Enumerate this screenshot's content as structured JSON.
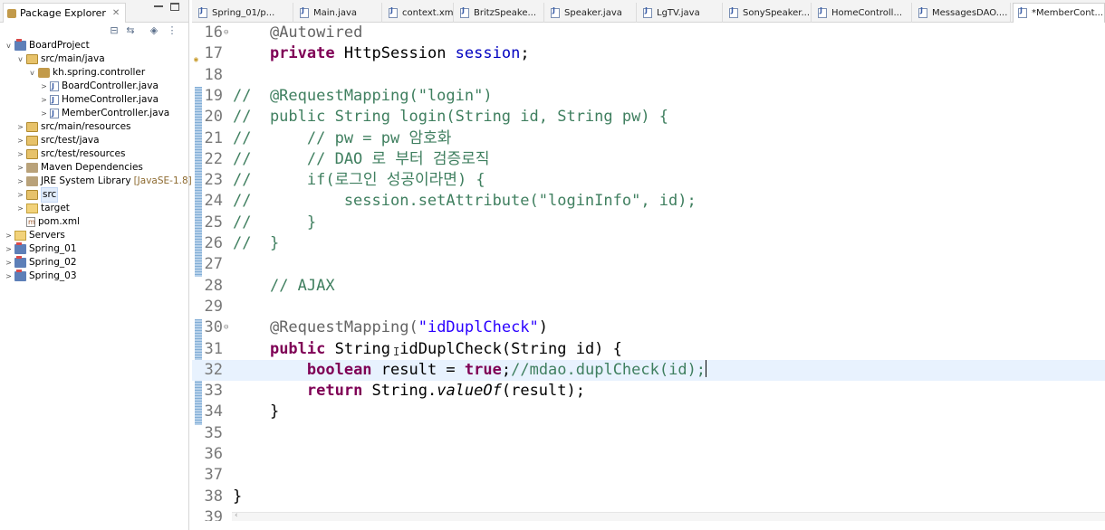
{
  "explorer": {
    "title": "Package Explorer",
    "close": "✕",
    "tree": [
      {
        "label": "BoardProject",
        "icon": "project-icon",
        "twisty": "v",
        "indent": 0
      },
      {
        "label": "src/main/java",
        "icon": "source-folder-icon",
        "twisty": "v",
        "indent": 1
      },
      {
        "label": "kh.spring.controller",
        "icon": "package-icon",
        "twisty": "v",
        "indent": 2
      },
      {
        "label": "BoardController.java",
        "icon": "java-file-icon",
        "twisty": ">",
        "indent": 3
      },
      {
        "label": "HomeController.java",
        "icon": "java-file-icon",
        "twisty": ">",
        "indent": 3
      },
      {
        "label": "MemberController.java",
        "icon": "java-file-icon",
        "twisty": ">",
        "indent": 3
      },
      {
        "label": "src/main/resources",
        "icon": "source-folder-icon",
        "twisty": ">",
        "indent": 1
      },
      {
        "label": "src/test/java",
        "icon": "source-folder-icon",
        "twisty": ">",
        "indent": 1
      },
      {
        "label": "src/test/resources",
        "icon": "source-folder-icon",
        "twisty": ">",
        "indent": 1
      },
      {
        "label": "Maven Dependencies",
        "icon": "library-icon",
        "twisty": ">",
        "indent": 1
      },
      {
        "label": "JRE System Library",
        "suffix": "[JavaSE-1.8]",
        "icon": "library-icon",
        "twisty": ">",
        "indent": 1
      },
      {
        "label": "src",
        "icon": "source-folder-icon",
        "twisty": ">",
        "indent": 1,
        "selected": true
      },
      {
        "label": "target",
        "icon": "folder-icon",
        "twisty": ">",
        "indent": 1
      },
      {
        "label": "pom.xml",
        "icon": "xml-file-icon",
        "twisty": "",
        "indent": 1
      },
      {
        "label": "Servers",
        "icon": "folder-icon",
        "twisty": ">",
        "indent": 0
      },
      {
        "label": "Spring_01",
        "icon": "project-icon",
        "twisty": ">",
        "indent": 0
      },
      {
        "label": "Spring_02",
        "icon": "project-icon",
        "twisty": ">",
        "indent": 0
      },
      {
        "label": "Spring_03",
        "icon": "project-icon",
        "twisty": ">",
        "indent": 0
      }
    ]
  },
  "editor": {
    "tabs": [
      {
        "label": "Spring_01/p...",
        "active": false
      },
      {
        "label": "Main.java",
        "active": false
      },
      {
        "label": "context.xml",
        "active": false
      },
      {
        "label": "BritzSpeake...",
        "active": false
      },
      {
        "label": "Speaker.java",
        "active": false
      },
      {
        "label": "LgTV.java",
        "active": false
      },
      {
        "label": "SonySpeaker....",
        "active": false
      },
      {
        "label": "HomeControll...",
        "active": false
      },
      {
        "label": "MessagesDAO....",
        "active": false
      },
      {
        "label": "*MemberCont...",
        "active": true
      }
    ],
    "lines": [
      {
        "num": "16",
        "fold": "⊖"
      },
      {
        "num": "17",
        "override": true
      },
      {
        "num": "18"
      },
      {
        "num": "19"
      },
      {
        "num": "20"
      },
      {
        "num": "21"
      },
      {
        "num": "22"
      },
      {
        "num": "23"
      },
      {
        "num": "24"
      },
      {
        "num": "25"
      },
      {
        "num": "26"
      },
      {
        "num": "27"
      },
      {
        "num": "28"
      },
      {
        "num": "29"
      },
      {
        "num": "30",
        "fold": "⊖"
      },
      {
        "num": "31"
      },
      {
        "num": "32",
        "current": true
      },
      {
        "num": "33"
      },
      {
        "num": "34"
      },
      {
        "num": "35"
      },
      {
        "num": "36"
      },
      {
        "num": "37"
      },
      {
        "num": "38"
      },
      {
        "num": "39"
      }
    ],
    "code": {
      "l16": {
        "ann": "@Autowired"
      },
      "l17": {
        "kw": "private",
        "type": " HttpSession ",
        "field": "session",
        "end": ";"
      },
      "l19": {
        "text": "//  @RequestMapping(\"login\")"
      },
      "l20": {
        "text": "//  public String login(String id, String pw) {"
      },
      "l21": {
        "text": "//      // pw = pw 암호화"
      },
      "l22": {
        "text": "//      // DAO 로 부터 검증로직"
      },
      "l23": {
        "text": "//      if(로그인 성공이라면) {"
      },
      "l24": {
        "text": "//          session.setAttribute(\"loginInfo\", id);"
      },
      "l25": {
        "text": "//      }"
      },
      "l26": {
        "text": "//  }"
      },
      "l28": {
        "text": "// AJAX"
      },
      "l30": {
        "ann": "@RequestMapping(",
        "str": "\"idDuplCheck\"",
        "end": ")"
      },
      "l31": {
        "kw": "public",
        "rest": " String idDuplCheck(String id) {"
      },
      "l32": {
        "kw": "boolean",
        "mid": " result = ",
        "kw2": "true",
        "semi": ";",
        "comment": "//mdao.duplCheck(id);"
      },
      "l33": {
        "kw": "return",
        "mid": " String.",
        "ital": "valueOf",
        "end": "(result);"
      },
      "l34": {
        "text": "}"
      },
      "l38": {
        "text": "}"
      }
    }
  }
}
